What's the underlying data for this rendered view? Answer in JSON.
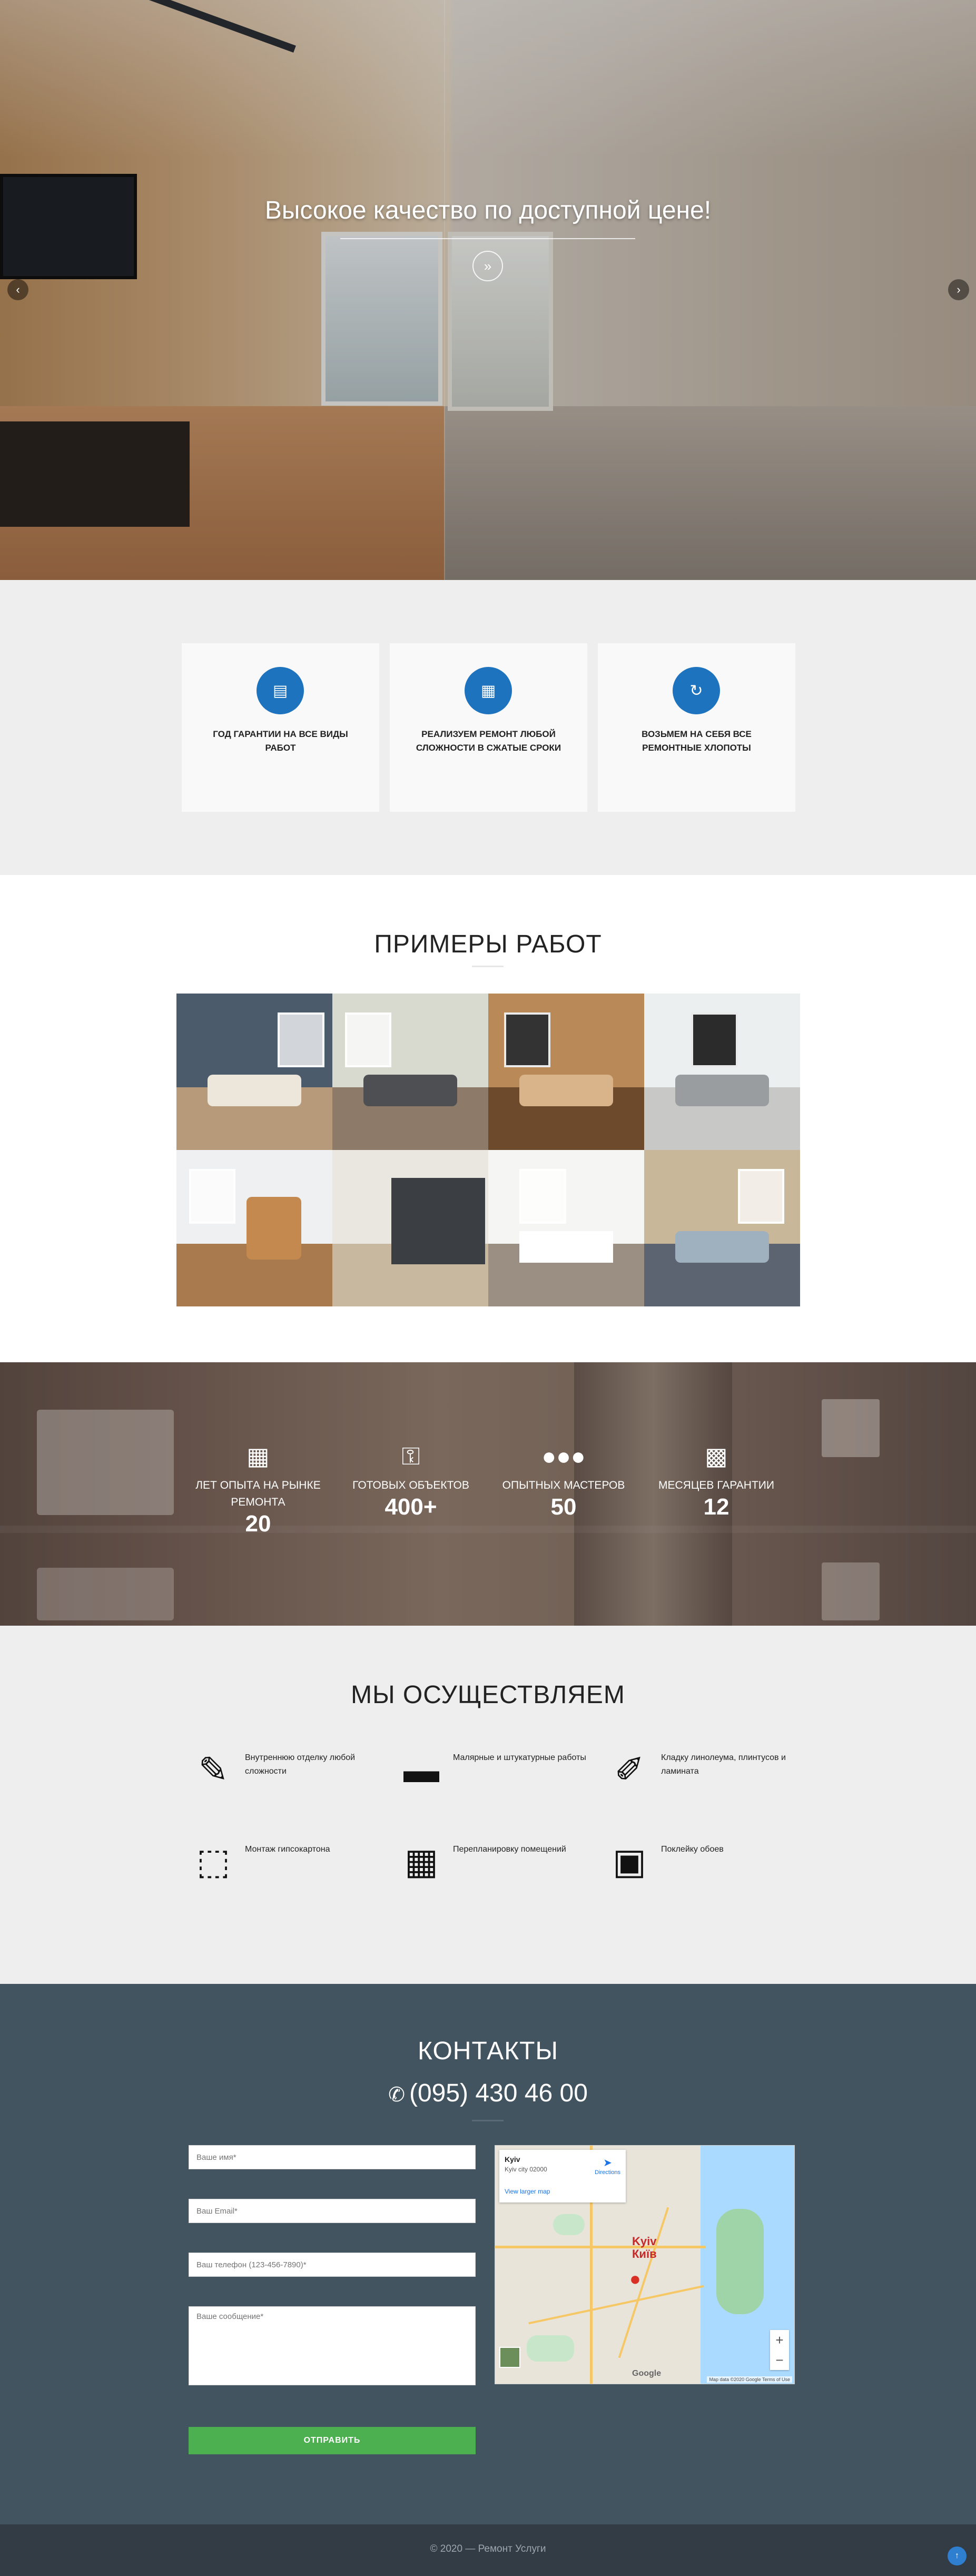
{
  "hero": {
    "title": "Высокое качество по доступной цене!",
    "scroll_icon": "double-chevron-down-icon",
    "prev_icon": "chevron-left-icon",
    "next_icon": "chevron-right-icon"
  },
  "features": [
    {
      "icon": "certificate-icon",
      "text": "Год гарантии на все виды работ"
    },
    {
      "icon": "building-icon",
      "text": "Реализуем ремонт любой сложности в сжатые сроки"
    },
    {
      "icon": "refresh-icon",
      "text": "Возьмем на себя все ремонтные хлопоты"
    }
  ],
  "works": {
    "title": "Примеры работ",
    "gallery_count": 8
  },
  "stats": [
    {
      "icon": "calendar-icon",
      "label": "Лет опыта на рынке ремонта",
      "value": "20"
    },
    {
      "icon": "key-icon",
      "label": "Готовых объектов",
      "value": "400+"
    },
    {
      "icon": "group-icon",
      "label": "Опытных мастеров",
      "value": "50"
    },
    {
      "icon": "card-icon",
      "label": "Месяцев гарантии",
      "value": "12"
    }
  ],
  "services": {
    "title": "Мы осуществляем",
    "items": [
      {
        "icon": "screwdriver-icon",
        "text": "Внутреннюю отделку любой сложности"
      },
      {
        "icon": "paint-roller-icon",
        "text": "Малярные и штукатурные работы"
      },
      {
        "icon": "pen-icon",
        "text": "Кладку линолеума, плинтусов и ламината"
      },
      {
        "icon": "drywall-icon",
        "text": "Монтаж гипсокартона"
      },
      {
        "icon": "brick-wall-icon",
        "text": "Перепланировку помещений"
      },
      {
        "icon": "image-icon",
        "text": "Поклейку обоев"
      }
    ]
  },
  "contacts": {
    "title": "Контакты",
    "phone": "(095) 430 46 00",
    "form": {
      "name_placeholder": "Ваше имя*",
      "email_placeholder": "Ваш Email*",
      "phone_placeholder": "Ваш телефон (123-456-7890)*",
      "message_placeholder": "Ваше сообщение*",
      "submit_label": "Отправить"
    },
    "map": {
      "city": "Kyiv",
      "address": "Kyiv city 02000",
      "larger_map_link": "View larger map",
      "directions_label": "Directions",
      "city_label_latin": "Kyiv",
      "city_label_cyrillic": "Київ",
      "google_label": "Google",
      "terms": "Map data ©2020 Google   Terms of Use"
    }
  },
  "footer": {
    "text": "© 2020 — Ремонт Услуги",
    "to_top_icon": "arrow-up-icon"
  }
}
